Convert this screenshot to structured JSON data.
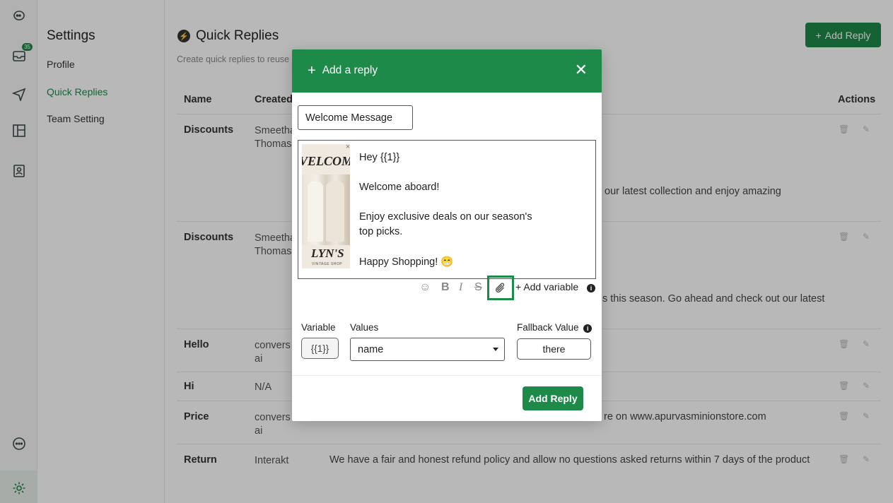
{
  "rail": {
    "inbox_badge": "35"
  },
  "settings": {
    "title": "Settings",
    "nav": [
      {
        "label": "Profile"
      },
      {
        "label": "Quick Replies"
      },
      {
        "label": "Team Setting"
      }
    ]
  },
  "main": {
    "title": "Quick Replies",
    "subtitle": "Create quick replies to reuse",
    "add_button": "Add Reply",
    "columns": {
      "name": "Name",
      "created": "Created",
      "actions": "Actions"
    },
    "rows": [
      {
        "name": "Discounts",
        "created_by": "Smeetha Thomas",
        "text": "our latest collection and enjoy amazing"
      },
      {
        "name": "Discounts",
        "created_by": "Smeetha Thomas",
        "text": "s this season. Go ahead and check out our latest"
      },
      {
        "name": "Hello",
        "created_by": "conversai",
        "text": ""
      },
      {
        "name": "Hi",
        "created_by": "N/A",
        "text": ""
      },
      {
        "name": "Price",
        "created_by": "conversai",
        "text": "re on www.apurvasminionstore.com"
      },
      {
        "name": "Return",
        "created_by": "Interakt",
        "text": "We have a fair and honest refund policy and allow no questions asked returns within 7 days of the product"
      }
    ]
  },
  "modal": {
    "title": "Add a reply",
    "name_value": "Welcome Message",
    "image": {
      "word_top": "VELCOM",
      "brand": "LYN'S",
      "tagline": "VINTAGE SHOP"
    },
    "message_lines": [
      "Hey {{1}}",
      "Welcome aboard!",
      "Enjoy exclusive deals on our season's",
      "top picks.",
      "Happy Shopping! 😁"
    ],
    "toolbar": {
      "add_variable": "Add variable"
    },
    "labels": {
      "variable": "Variable",
      "values": "Values",
      "fallback": "Fallback Value"
    },
    "variable_chip": "{{1}}",
    "values_selected": "name",
    "fallback_value": "there",
    "submit": "Add Reply"
  },
  "colors": {
    "brand_green": "#1e8a4a"
  }
}
